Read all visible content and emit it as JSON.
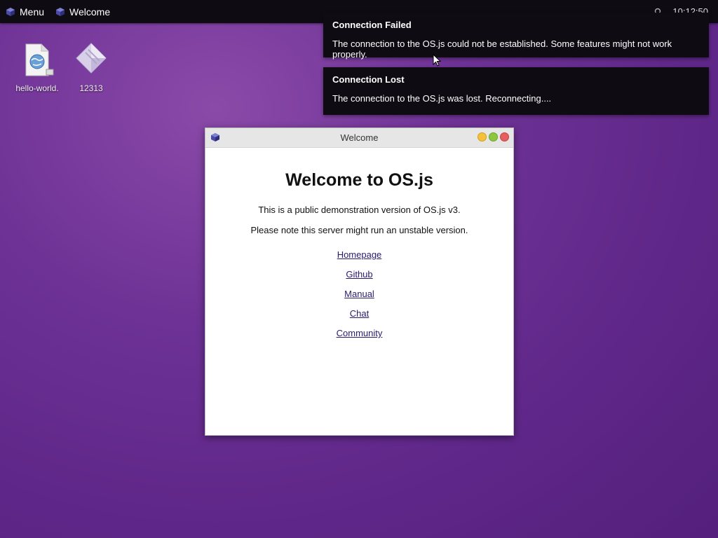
{
  "taskbar": {
    "menu_label": "Menu",
    "window_label": "Welcome",
    "clock": "10:12:50"
  },
  "desktop": {
    "icons": [
      {
        "label": "hello-world.",
        "icon": "web-file-icon"
      },
      {
        "label": "12313",
        "icon": "diamond-file-icon"
      }
    ]
  },
  "notifications": [
    {
      "title": "Connection Failed",
      "message": "The connection to the OS.js could not be established. Some features might not work properly."
    },
    {
      "title": "Connection Lost",
      "message": "The connection to the OS.js was lost. Reconnecting...."
    }
  ],
  "window": {
    "title": "Welcome",
    "heading": "Welcome to OS.js",
    "line1": "This is a public demonstration version of OS.js v3.",
    "line2": "Please note this server might run an unstable version.",
    "links": [
      "Homepage",
      "Github",
      "Manual",
      "Chat",
      "Community"
    ]
  },
  "colors": {
    "accent_cube": "#3b3b8c",
    "link": "#2a1a6e"
  }
}
